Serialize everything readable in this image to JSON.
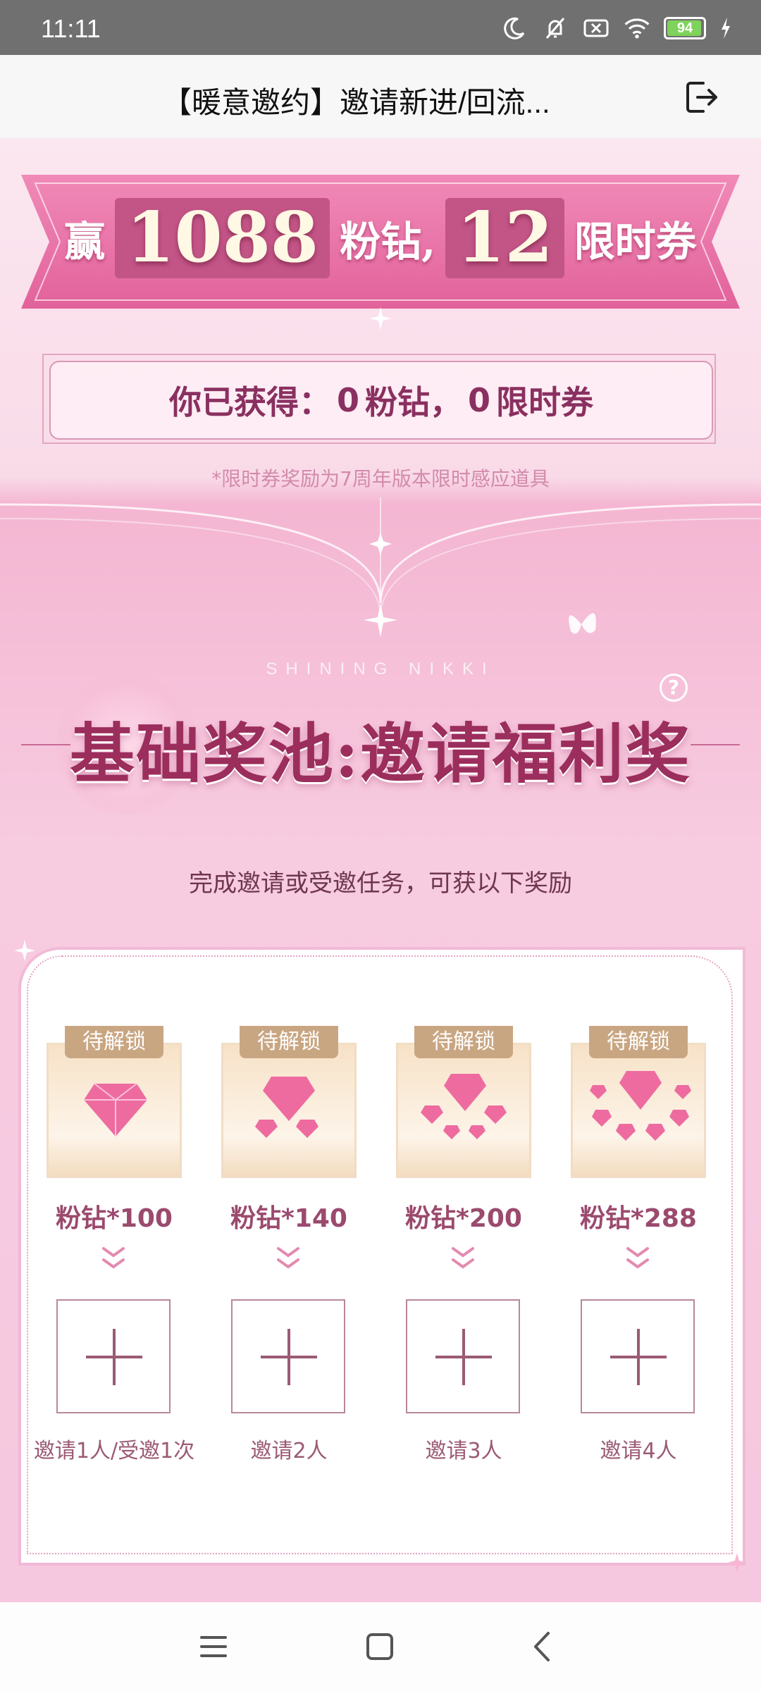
{
  "status_bar": {
    "time": "11:11",
    "battery": "94"
  },
  "header": {
    "title": "【暖意邀约】邀请新进/回流...",
    "exit_icon": "exit-icon"
  },
  "banner": {
    "prefix": "赢",
    "diamond_amount": "1088",
    "diamond_label": "粉钻,",
    "ticket_amount": "12",
    "ticket_label": "限时券"
  },
  "earned": {
    "prefix": "你已获得：",
    "diamonds": "0",
    "diamond_unit": "粉钻，",
    "tickets": "0",
    "ticket_unit": "限时券"
  },
  "note": "*限时券奖励为7周年版本限时感应道具",
  "pool": {
    "brand": "SHINING NIKKI",
    "title": "基础奖池:邀请福利奖",
    "help_icon": "question-icon"
  },
  "subtitle": "完成邀请或受邀任务，可获以下奖励",
  "rewards": [
    {
      "lock": "待解锁",
      "label": "粉钻*100",
      "task": "邀请1人/受邀1次"
    },
    {
      "lock": "待解锁",
      "label": "粉钻*140",
      "task": "邀请2人"
    },
    {
      "lock": "待解锁",
      "label": "粉钻*200",
      "task": "邀请3人"
    },
    {
      "lock": "待解锁",
      "label": "粉钻*288",
      "task": "邀请4人"
    }
  ],
  "colors": {
    "accent": "#9b2e5c",
    "background": "#f6c6dc",
    "lock_tag": "#c9a682"
  }
}
